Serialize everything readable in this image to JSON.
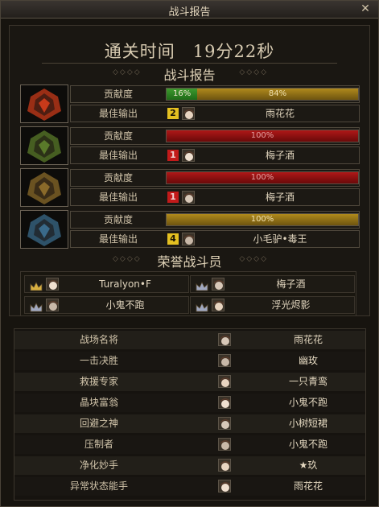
{
  "window": {
    "title": "战斗报告",
    "close_icon": "close-icon"
  },
  "clear_time": "通关时间　19分22秒",
  "report_title": "战斗报告",
  "honor_title": "荣誉战斗员",
  "labels": {
    "contribution": "贡献度",
    "best_output": "最佳输出"
  },
  "players": [
    {
      "class_icon": "fire-warrior-emblem",
      "color": "#c83a1a",
      "segments": [
        {
          "pct": 16,
          "text": "16%",
          "style": "green"
        },
        {
          "pct": 84,
          "text": "84%",
          "style": "gold"
        }
      ],
      "rank": "2",
      "rank_style": "gold",
      "name": "雨花花"
    },
    {
      "class_icon": "green-armor-emblem",
      "color": "#5a7a2a",
      "segments": [
        {
          "pct": 100,
          "text": "100%",
          "style": "red"
        }
      ],
      "rank": "1",
      "rank_style": "red",
      "name": "梅子酒"
    },
    {
      "class_icon": "gold-armor-emblem",
      "color": "#8a6a2a",
      "segments": [
        {
          "pct": 100,
          "text": "100%",
          "style": "red"
        }
      ],
      "rank": "1",
      "rank_style": "red",
      "name": "梅子酒"
    },
    {
      "class_icon": "blue-armor-emblem",
      "color": "#3a6a8a",
      "segments": [
        {
          "pct": 100,
          "text": "100%",
          "style": "gold"
        }
      ],
      "rank": "4",
      "rank_style": "gold",
      "name": "小毛驴•毒王"
    }
  ],
  "honors": [
    {
      "name": "Turalyon•F",
      "crown": "gold"
    },
    {
      "name": "梅子酒",
      "crown": "silver"
    },
    {
      "name": "小鬼不跑",
      "crown": "silver"
    },
    {
      "name": "浮光烬影",
      "crown": "silver"
    }
  ],
  "awards": [
    {
      "title": "战场名将",
      "name": "雨花花"
    },
    {
      "title": "一击决胜",
      "name": "幽玫"
    },
    {
      "title": "救援专家",
      "name": "一只青鸾"
    },
    {
      "title": "晶块富翁",
      "name": "小鬼不跑"
    },
    {
      "title": "回避之神",
      "name": "小树短裙"
    },
    {
      "title": "压制者",
      "name": "小鬼不跑"
    },
    {
      "title": "净化妙手",
      "name": "★玖"
    },
    {
      "title": "异常状态能手",
      "name": "雨花花"
    }
  ]
}
